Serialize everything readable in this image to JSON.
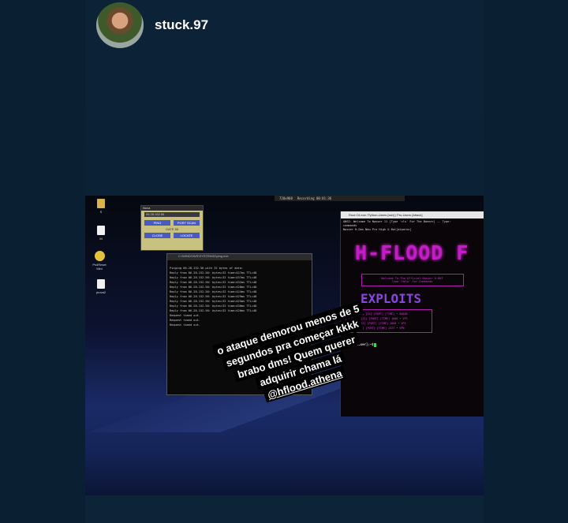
{
  "story": {
    "username": "stuck.97",
    "caption_lines": [
      "o ataque demorou menos de 5",
      "segundos pra começar kkkk",
      "brabo dms! Quem querer",
      "adquirir chama lá",
      "@hflood.athena"
    ]
  },
  "screenshot": {
    "taskbar": {
      "fps": "720x960",
      "recording": "Recording 00:01:36"
    },
    "desktop_icons": [
      "S",
      "M",
      "Ps4Reset Mini",
      "prova2"
    ],
    "panel": {
      "title": "Nova",
      "ip_field": "06.28.152.56",
      "buttons": [
        "PING",
        "PORT SCAN",
        "CLOSE",
        "LOCATE"
      ],
      "middle_label": "GATE 56"
    },
    "ping_terminal": {
      "title": "C:\\WINDOWS\\SYSTEM32\\ping.exe",
      "lines": [
        "Pinging 06.28.152.56 with 32 bytes of data:",
        "Reply from 06.28.152.56: bytes=32 time=427ms TTL=48",
        "Reply from 06.28.152.56: bytes=32 time=437ms TTL=48",
        "Reply from 06.28.152.56: bytes=32 time=432ms TTL=48",
        "Reply from 06.28.152.56: bytes=32 time=428ms TTL=48",
        "Reply from 06.28.152.56: bytes=32 time=424ms TTL=48",
        "Reply from 06.28.152.56: bytes=32 time=429ms TTL=48",
        "Reply from 06.28.152.56: bytes=32 time=425ms TTL=48",
        "Reply from 06.28.152.56: bytes=32 time=430ms TTL=48",
        "Reply from 06.28.152.56: bytes=32 time=426ms TTL=48",
        "Request timed out.",
        "Request timed out.",
        "Request timed out."
      ]
    },
    "flood_window": {
      "title": "Root Cli.exe: Python-Users [ssh] | Pro-Users [Attack]",
      "header_lines": [
        "ANSI: Welcome To Nasser 11 [Type 'cls' For The Banner] -- Type: ",
        "commands",
        "Nasser H-Dos New Pro High & Bot[diporos]"
      ],
      "logo": "H-FLOOD F",
      "welcome_lines": [
        "Welcome To The Official Nasser H-BOT",
        "Type 'Help' For Commands"
      ],
      "exploits_title": "EXPLOITS",
      "exploit_list": [
        "* SERVER-1 [22] [PORT] [TIME] • 80888",
        "* VDS-X [22] [PORT] [TIME] 1800 • VPS",
        "* AD-X [22] [PORT] [TIME] 1800 • VPS",
        "* VPS [22] [PORT] [TIME] 1337 • VPN"
      ],
      "prompt": "root@[Nasser]:~$"
    }
  }
}
